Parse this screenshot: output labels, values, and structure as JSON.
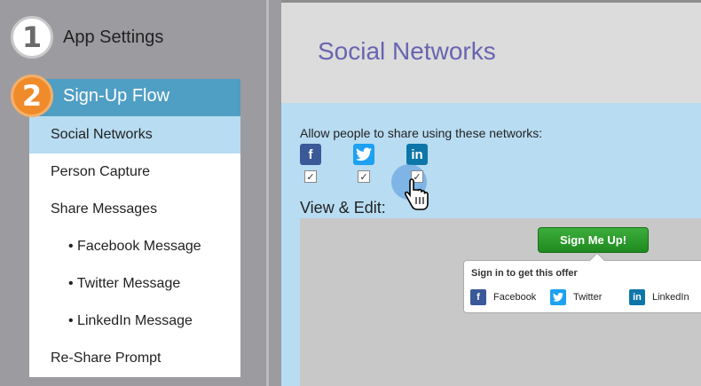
{
  "sidebar": {
    "steps": [
      {
        "number": "1",
        "label": "App Settings"
      },
      {
        "number": "2",
        "label": "Sign-Up Flow"
      }
    ],
    "menu": [
      {
        "label": "Social Networks",
        "active": true
      },
      {
        "label": "Person Capture"
      },
      {
        "label": "Share Messages"
      },
      {
        "label": "• Facebook Message",
        "sub": true
      },
      {
        "label": "• Twitter Message",
        "sub": true
      },
      {
        "label": "• LinkedIn Message",
        "sub": true
      },
      {
        "label": "Re-Share Prompt"
      }
    ]
  },
  "main": {
    "title": "Social Networks",
    "allow_text": "Allow people to share using these networks:",
    "networks": [
      {
        "icon": "facebook-icon",
        "glyph": "f",
        "checked": true
      },
      {
        "icon": "twitter-icon",
        "glyph": "t",
        "checked": true
      },
      {
        "icon": "linkedin-icon",
        "glyph": "in",
        "checked": true
      }
    ],
    "view_edit": "View & Edit:",
    "preview": {
      "button": "Sign Me Up!",
      "popup_title": "Sign in to get this offer",
      "popup_networks": [
        "Facebook",
        "Twitter",
        "LinkedIn"
      ]
    }
  },
  "colors": {
    "accent_blue": "#4f9ec4",
    "step_orange": "#f08b2b",
    "title_purple": "#6a64b0",
    "panel_blue": "#b8dcf2",
    "signup_green": "#2a9a2a"
  }
}
